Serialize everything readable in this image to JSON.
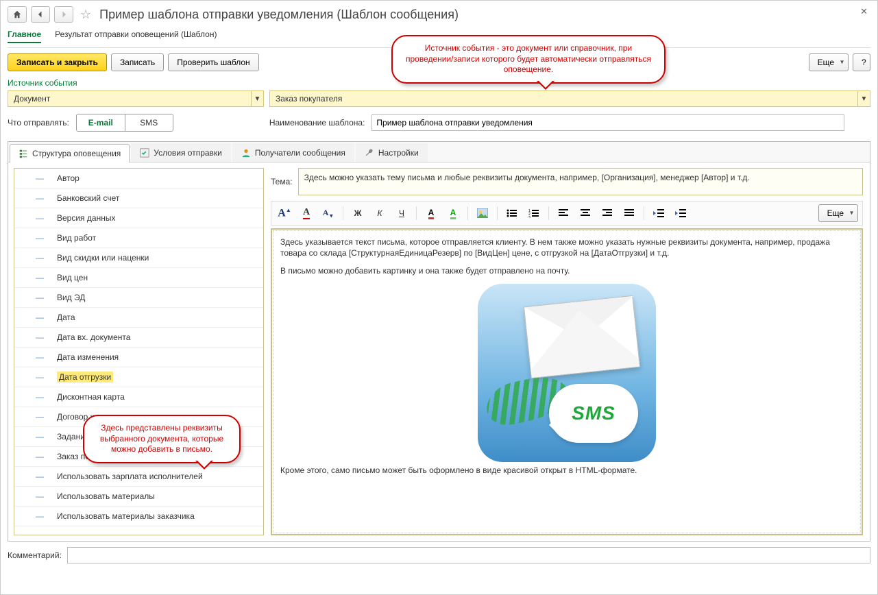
{
  "header": {
    "title": "Пример шаблона отправки уведомления (Шаблон сообщения)"
  },
  "crumbs": {
    "main": "Главное",
    "alt": "Результат отправки оповещений (Шаблон)"
  },
  "toolbar": {
    "save_close": "Записать и закрыть",
    "save": "Записать",
    "check": "Проверить шаблон",
    "more": "Еще",
    "help": "?"
  },
  "callout_top": "Источник события - это документ или справочник, при проведении/записи которого будет автоматически отправляться оповещение.",
  "source": {
    "label": "Источник события",
    "type": "Документ",
    "value": "Заказ покупателя"
  },
  "send": {
    "label": "Что отправлять:",
    "email": "E-mail",
    "sms": "SMS"
  },
  "template_name": {
    "label": "Наименование шаблона:",
    "value": "Пример шаблона отправки уведомления"
  },
  "tabs": {
    "structure": "Структура оповещения",
    "conditions": "Условия отправки",
    "recipients": "Получатели сообщения",
    "settings": "Настройки"
  },
  "tree": [
    "Автор",
    "Банковский счет",
    "Версия данных",
    "Вид работ",
    "Вид скидки или наценки",
    "Вид цен",
    "Вид ЭД",
    "Дата",
    "Дата вх. документа",
    "Дата изменения",
    "Дата отгрузки",
    "Дисконтная карта",
    "Договор контрагента",
    "Задание на работу",
    "Заказ покупателя",
    "Использовать зарплата исполнителей",
    "Использовать материалы",
    "Использовать материалы заказчика"
  ],
  "tree_highlight_index": 10,
  "callout_left": "Здесь представлены реквизиты выбранного документа, которые можно добавить в письмо.",
  "theme": {
    "label": "Тема:",
    "value": "Здесь можно указать тему письма и любые реквизиты документа, например, [Организация], менеджер [Автор] и т.д."
  },
  "editor_toolbar": {
    "icons": [
      "font-size-increase",
      "font-color",
      "font-size-decrease",
      "bold",
      "italic",
      "underline",
      "text-color",
      "highlight-color",
      "insert-image",
      "bullet-list",
      "numbered-list",
      "align-left",
      "align-center",
      "align-right",
      "align-justify",
      "outdent",
      "indent"
    ],
    "more": "Еще"
  },
  "editor": {
    "p1": "Здесь указывается текст письма, которое отправляется клиенту. В нем также можно указать нужные реквизиты документа, например, продажа товара со склада [СтруктурнаяЕдиницаРезерв] по [ВидЦен] цене, с отгрузкой на [ДатаОтгрузки] и т.д.",
    "p2": "В письмо можно добавить картинку и она также будет отправлено на почту.",
    "p3": "Кроме этого, само письмо может быть оформлено в виде красивой открыт в HTML-формате.",
    "sms_text": "SMS"
  },
  "comment": {
    "label": "Комментарий:",
    "value": ""
  },
  "colors": {
    "accent_green": "#0a7a3a",
    "accent_red": "#c00",
    "field_yellow": "#fff7cc"
  }
}
